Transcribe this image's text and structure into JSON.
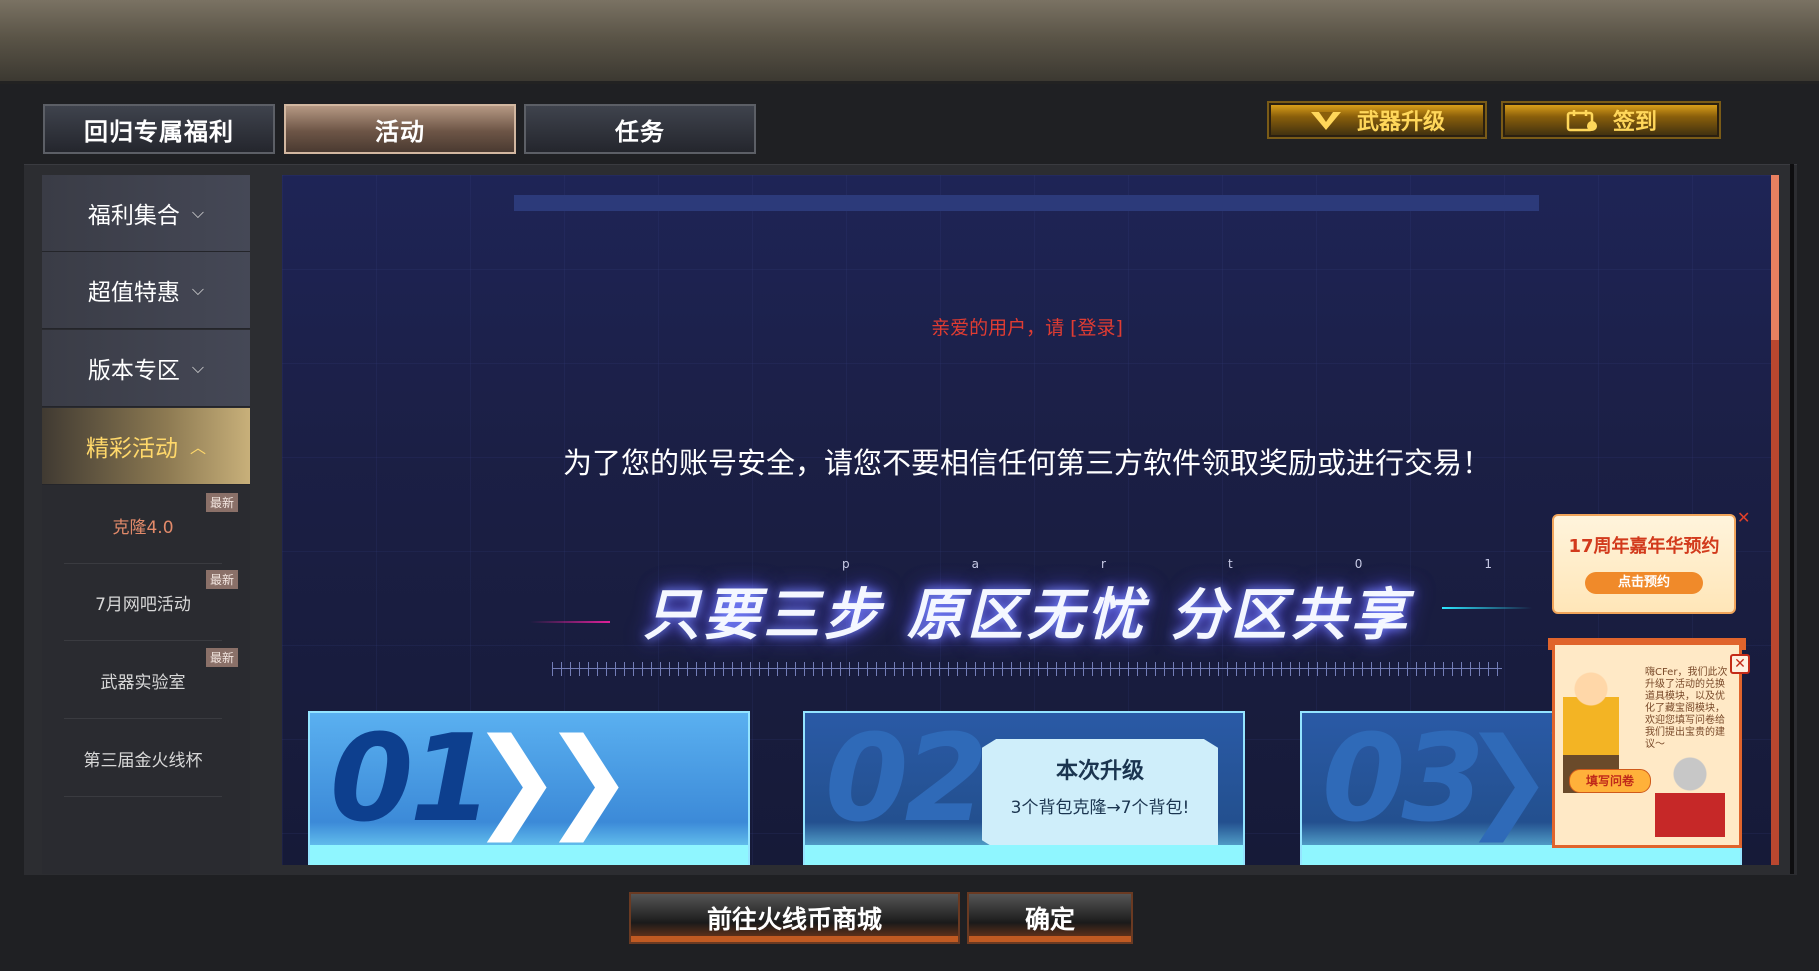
{
  "tabs": [
    {
      "label": "回归专属福利",
      "active": false
    },
    {
      "label": "活动",
      "active": true
    },
    {
      "label": "任务",
      "active": false
    }
  ],
  "top_buttons": {
    "weapon_upgrade": "武器升级",
    "sign_in": "签到"
  },
  "sidebar": {
    "items": [
      {
        "label": "福利集合",
        "expanded": false
      },
      {
        "label": "超值特惠",
        "expanded": false
      },
      {
        "label": "版本专区",
        "expanded": false
      },
      {
        "label": "精彩活动",
        "expanded": true
      }
    ],
    "sub_items": [
      {
        "label": "克隆4.0",
        "badge": "最新",
        "active": true
      },
      {
        "label": "7月网吧活动",
        "badge": "最新",
        "active": false
      },
      {
        "label": "武器实验室",
        "badge": "最新",
        "active": false
      },
      {
        "label": "第三届金火线杯",
        "badge": "",
        "active": false
      }
    ]
  },
  "content": {
    "login_prompt": "亲爱的用户，请 [登录]",
    "security_warning": "为了您的账号安全，请您不要相信任何第三方软件领取奖励或进行交易！",
    "part_label": [
      "p",
      "a",
      "r",
      "t",
      "0",
      "1"
    ],
    "headline": "只要三步 原区无忧 分区共享",
    "cards": [
      {
        "number": "01",
        "arrows": "❯❯"
      },
      {
        "number": "02",
        "arrows": "❯❯"
      },
      {
        "number": "03",
        "arrows": "❯❯"
      }
    ],
    "upgrade_box": {
      "title": "本次升级",
      "subtitle": "3个背包克隆→7个背包!"
    }
  },
  "floating": {
    "promo": {
      "title": "17周年嘉年华预约",
      "button": "点击预约",
      "close": "✕"
    },
    "survey": {
      "text": "嗨CFer，我们此次升级了活动的兑换道具模块，以及优化了藏宝阁模块，欢迎您填写问卷给我们提出宝贵的建议～",
      "button": "填写问卷",
      "close": "✕"
    }
  },
  "bottom_buttons": {
    "shop": "前往火线币商城",
    "confirm": "确定"
  },
  "colors": {
    "accent_gold": "#ffd75a",
    "login_red": "#e03c32",
    "active_sub": "#e28a6a"
  }
}
